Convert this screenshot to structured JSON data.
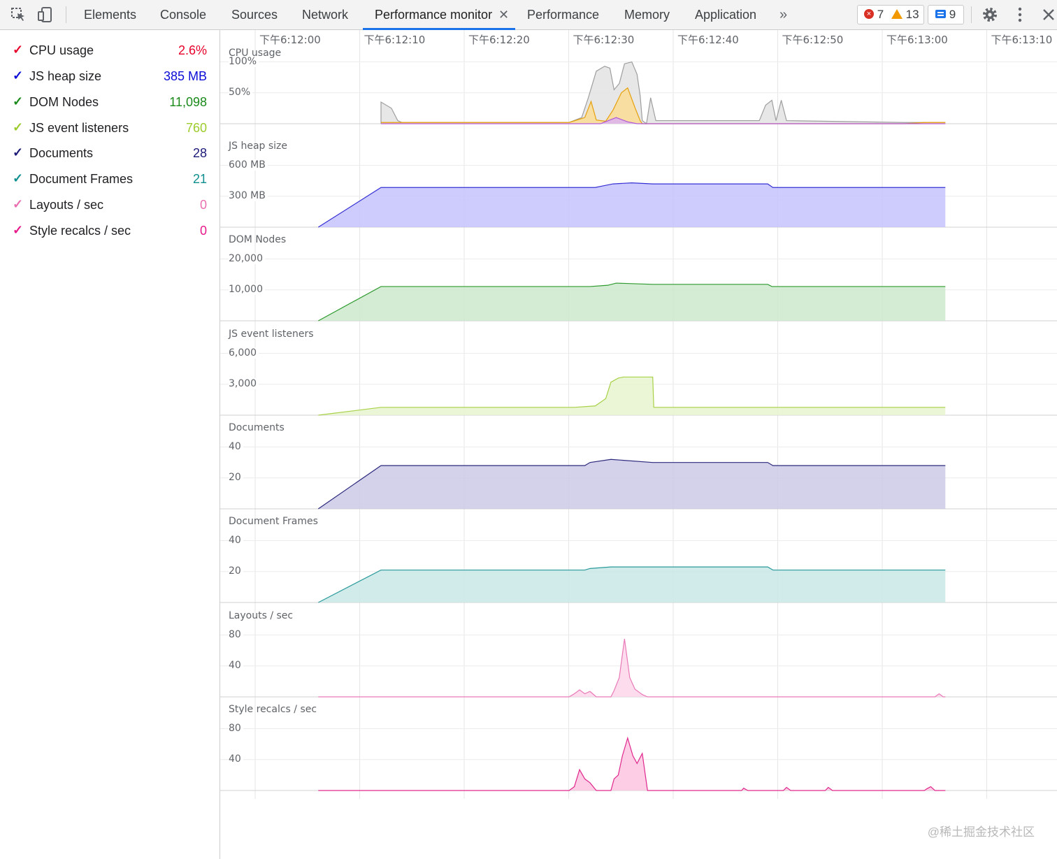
{
  "toolbar": {
    "tabs": [
      {
        "label": "Elements"
      },
      {
        "label": "Console"
      },
      {
        "label": "Sources"
      },
      {
        "label": "Network"
      },
      {
        "label": "Performance monitor",
        "active": true
      },
      {
        "label": "Performance"
      },
      {
        "label": "Memory"
      },
      {
        "label": "Application"
      }
    ],
    "close_tab_glyph": "✕",
    "overflow_glyph": "»",
    "errors_count": "7",
    "warnings_count": "13",
    "messages_count": "9",
    "icons": [
      "inspect-element-icon",
      "device-toolbar-icon",
      "overflow-chevron-icon",
      "error-icon",
      "warning-icon",
      "message-icon",
      "settings-gear-icon",
      "more-vertical-icon",
      "close-devtools-icon"
    ]
  },
  "metrics": [
    {
      "label": "CPU usage",
      "value": "2.6%",
      "color": "#e8002a"
    },
    {
      "label": "JS heap size",
      "value": "385 MB",
      "color": "#0d0dd7"
    },
    {
      "label": "DOM Nodes",
      "value": "11,098",
      "color": "#1b8a1b"
    },
    {
      "label": "JS event listeners",
      "value": "760",
      "color": "#9ccc2b"
    },
    {
      "label": "Documents",
      "value": "28",
      "color": "#1c1a78"
    },
    {
      "label": "Document Frames",
      "value": "21",
      "color": "#0f8f8f"
    },
    {
      "label": "Layouts / sec",
      "value": "0",
      "color": "#ea6fb0"
    },
    {
      "label": "Style recalcs / sec",
      "value": "0",
      "color": "#e8198b"
    }
  ],
  "time_labels": [
    "下午6:12:00",
    "下午6:12:10",
    "下午6:12:20",
    "下午6:12:30",
    "下午6:12:40",
    "下午6:12:50",
    "下午6:13:00",
    "下午6:13:10"
  ],
  "panels": [
    {
      "title": "CPU usage",
      "ticks": [
        "100%",
        "50%"
      ]
    },
    {
      "title": "JS heap size",
      "ticks": [
        "600 MB",
        "300 MB"
      ]
    },
    {
      "title": "DOM Nodes",
      "ticks": [
        "20,000",
        "10,000"
      ]
    },
    {
      "title": "JS event listeners",
      "ticks": [
        "6,000",
        "3,000"
      ]
    },
    {
      "title": "Documents",
      "ticks": [
        "40",
        "20"
      ]
    },
    {
      "title": "Document Frames",
      "ticks": [
        "40",
        "20"
      ]
    },
    {
      "title": "Layouts / sec",
      "ticks": [
        "80",
        "40"
      ]
    },
    {
      "title": "Style recalcs / sec",
      "ticks": [
        "80",
        "40"
      ]
    }
  ],
  "chart_data": {
    "type": "area",
    "x_unit": "time",
    "x": [
      "下午6:12:00",
      "下午6:12:10",
      "下午6:12:20",
      "下午6:12:30",
      "下午6:12:40",
      "下午6:12:50",
      "下午6:13:00",
      "下午6:13:10"
    ],
    "series": [
      {
        "name": "CPU usage",
        "color": "#9e9e9e",
        "fill": "#e3e3e3",
        "ymax": 100,
        "points": [
          [
            6,
            0
          ],
          [
            6,
            35
          ],
          [
            7,
            25
          ],
          [
            7.6,
            5
          ],
          [
            8,
            2
          ],
          [
            24,
            2
          ],
          [
            25.2,
            10
          ],
          [
            25.8,
            40
          ],
          [
            26.6,
            85
          ],
          [
            27.4,
            93
          ],
          [
            27.9,
            90
          ],
          [
            28.3,
            55
          ],
          [
            28.8,
            65
          ],
          [
            29.3,
            97
          ],
          [
            30,
            100
          ],
          [
            30.5,
            80
          ],
          [
            30.8,
            45
          ],
          [
            31,
            5
          ],
          [
            31.4,
            0
          ],
          [
            31.8,
            42
          ],
          [
            32.3,
            5
          ],
          [
            42.2,
            5
          ],
          [
            42.8,
            30
          ],
          [
            43.4,
            38
          ],
          [
            43.8,
            5
          ],
          [
            44.3,
            38
          ],
          [
            44.8,
            5
          ],
          [
            56,
            2
          ],
          [
            60,
            2
          ]
        ]
      },
      {
        "name": "CPU scripting",
        "color": "#e5a10e",
        "fill": "#fbdc94",
        "ymax": 100,
        "points": [
          [
            6,
            2
          ],
          [
            8,
            2
          ],
          [
            12,
            2
          ],
          [
            24,
            2
          ],
          [
            25.5,
            10
          ],
          [
            26.1,
            36
          ],
          [
            26.6,
            6
          ],
          [
            27.5,
            4
          ],
          [
            28.2,
            22
          ],
          [
            29,
            50
          ],
          [
            29.6,
            58
          ],
          [
            30.3,
            26
          ],
          [
            30.8,
            5
          ],
          [
            31,
            0
          ],
          [
            56,
            0
          ],
          [
            58,
            2
          ],
          [
            60,
            2
          ]
        ]
      },
      {
        "name": "CPU rendering",
        "color": "#b05ad8",
        "fill": "#dcb3f0",
        "ymax": 100,
        "points": [
          [
            6,
            0
          ],
          [
            27,
            0
          ],
          [
            27.6,
            4
          ],
          [
            28.5,
            10
          ],
          [
            29.6,
            3
          ],
          [
            30.5,
            0
          ],
          [
            60,
            0
          ]
        ]
      },
      {
        "name": "JS heap size",
        "color": "#3530d4",
        "fill": "#c5c3fb",
        "ymax": 600,
        "points": [
          [
            0,
            0
          ],
          [
            6,
            385
          ],
          [
            26.5,
            385
          ],
          [
            27.2,
            400
          ],
          [
            28.2,
            420
          ],
          [
            30,
            430
          ],
          [
            32,
            420
          ],
          [
            43,
            420
          ],
          [
            43.5,
            385
          ],
          [
            60,
            385
          ]
        ]
      },
      {
        "name": "DOM Nodes",
        "color": "#2e9b2e",
        "fill": "#cce8cc",
        "ymax": 20000,
        "points": [
          [
            0,
            0
          ],
          [
            6,
            11098
          ],
          [
            26,
            11098
          ],
          [
            27.7,
            11500
          ],
          [
            28.5,
            12200
          ],
          [
            32,
            11800
          ],
          [
            43,
            11800
          ],
          [
            43.4,
            11098
          ],
          [
            60,
            11098
          ]
        ]
      },
      {
        "name": "JS event listeners",
        "color": "#a7d146",
        "fill": "#e8f4cf",
        "ymax": 6000,
        "points": [
          [
            0,
            0
          ],
          [
            6,
            760
          ],
          [
            24.5,
            760
          ],
          [
            26.5,
            900
          ],
          [
            27.5,
            1600
          ],
          [
            28,
            3200
          ],
          [
            28.7,
            3600
          ],
          [
            29.2,
            3700
          ],
          [
            32,
            3700
          ],
          [
            32.1,
            760
          ],
          [
            60,
            760
          ]
        ]
      },
      {
        "name": "Documents",
        "color": "#2c2a7c",
        "fill": "#ccc9e6",
        "ymax": 40,
        "points": [
          [
            0,
            0
          ],
          [
            6,
            28
          ],
          [
            25.5,
            28
          ],
          [
            26,
            30
          ],
          [
            28,
            32
          ],
          [
            32,
            30
          ],
          [
            43,
            30
          ],
          [
            43.5,
            28
          ],
          [
            60,
            28
          ]
        ]
      },
      {
        "name": "Document Frames",
        "color": "#2a9a9a",
        "fill": "#c9e7e7",
        "ymax": 40,
        "points": [
          [
            0,
            0
          ],
          [
            6,
            21
          ],
          [
            25.5,
            21
          ],
          [
            26,
            22
          ],
          [
            28,
            23
          ],
          [
            43,
            23
          ],
          [
            43.5,
            21
          ],
          [
            60,
            21
          ]
        ]
      },
      {
        "name": "Layouts / sec",
        "color": "#e97ab7",
        "fill": "#fcd6ea",
        "ymax": 80,
        "points": [
          [
            0,
            0
          ],
          [
            24,
            0
          ],
          [
            24.5,
            4
          ],
          [
            25,
            9
          ],
          [
            25.5,
            4
          ],
          [
            26,
            7
          ],
          [
            26.6,
            0
          ],
          [
            28,
            0
          ],
          [
            28.3,
            8
          ],
          [
            28.8,
            25
          ],
          [
            29.3,
            75
          ],
          [
            29.8,
            25
          ],
          [
            30.3,
            10
          ],
          [
            31,
            3
          ],
          [
            31.5,
            0
          ],
          [
            59,
            0
          ],
          [
            59.4,
            4
          ],
          [
            59.8,
            0
          ],
          [
            60,
            0
          ]
        ]
      },
      {
        "name": "Style recalcs / sec",
        "color": "#e0288d",
        "fill": "#fbc4e1",
        "ymax": 80,
        "points": [
          [
            0,
            0
          ],
          [
            24,
            0
          ],
          [
            24.5,
            5
          ],
          [
            25,
            27
          ],
          [
            25.5,
            15
          ],
          [
            26,
            10
          ],
          [
            26.6,
            0
          ],
          [
            28,
            0
          ],
          [
            28.3,
            15
          ],
          [
            28.7,
            20
          ],
          [
            29.1,
            45
          ],
          [
            29.6,
            68
          ],
          [
            30.1,
            45
          ],
          [
            30.5,
            35
          ],
          [
            31,
            48
          ],
          [
            31.5,
            0
          ],
          [
            40.5,
            0
          ],
          [
            40.7,
            3
          ],
          [
            41.1,
            0
          ],
          [
            44.5,
            0
          ],
          [
            44.8,
            4
          ],
          [
            45.2,
            0
          ],
          [
            48.5,
            0
          ],
          [
            48.8,
            4
          ],
          [
            49.2,
            0
          ],
          [
            58,
            0
          ],
          [
            58.2,
            2
          ],
          [
            58.6,
            5
          ],
          [
            59,
            0
          ],
          [
            60,
            0
          ]
        ]
      }
    ]
  },
  "watermark": "@稀土掘金技术社区"
}
